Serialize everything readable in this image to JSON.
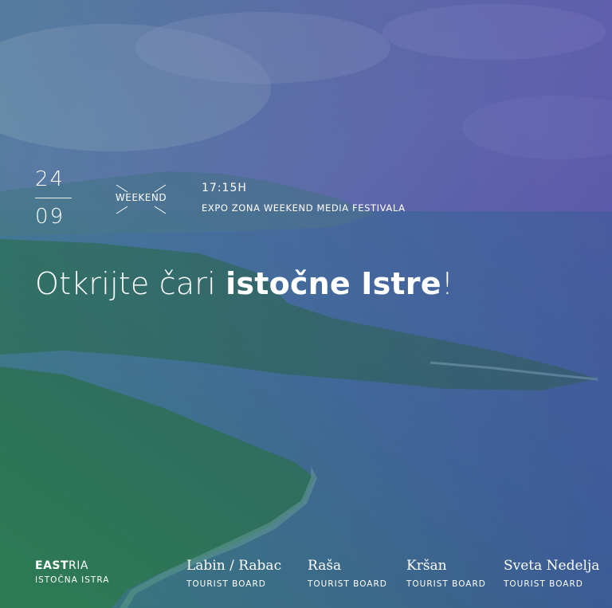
{
  "event": {
    "day": "24",
    "month": "09",
    "badge": "WEEKEND",
    "time": "17:15H",
    "venue": "EXPO ZONA WEEKEND MEDIA FESTIVALA"
  },
  "headline": {
    "light": "Otkrijte čari ",
    "bold": "istočne Istre",
    "end": "!"
  },
  "logo": {
    "strong": "EAST",
    "light": "RIA",
    "sub": "ISTOČNA ISTRA"
  },
  "boards": [
    {
      "name": "Labin / Rabac",
      "sub": "TOURIST BOARD"
    },
    {
      "name": "Raša",
      "sub": "TOURIST BOARD"
    },
    {
      "name": "Kršan",
      "sub": "TOURIST BOARD"
    },
    {
      "name": "Sveta Nedelja",
      "sub": "TOURIST BOARD"
    }
  ],
  "colors": {
    "sea": "#3d6f95",
    "forest": "#2e6a4a",
    "sky_tint": "#6a5fb0"
  }
}
